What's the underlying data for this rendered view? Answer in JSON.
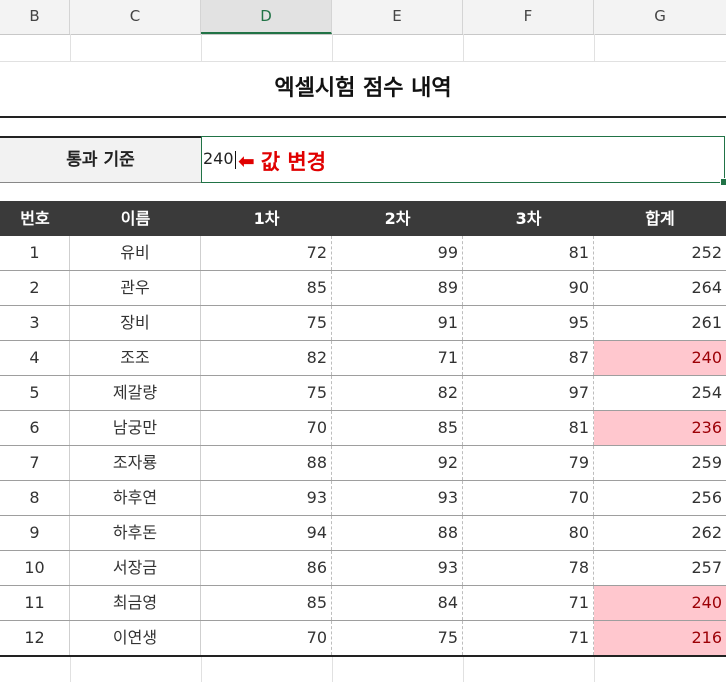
{
  "sheet": {
    "columns": [
      "B",
      "C",
      "D",
      "E",
      "F",
      "G"
    ],
    "selected_column": "D"
  },
  "title": "엑셀시험 점수 내역",
  "criteria": {
    "label": "통과 기준",
    "value": "240",
    "annotation": "값 변경"
  },
  "table": {
    "headers": [
      "번호",
      "이름",
      "1차",
      "2차",
      "3차",
      "합계"
    ],
    "rows": [
      {
        "no": "1",
        "name": "유비",
        "s1": "72",
        "s2": "99",
        "s3": "81",
        "total": "252",
        "highlight": false
      },
      {
        "no": "2",
        "name": "관우",
        "s1": "85",
        "s2": "89",
        "s3": "90",
        "total": "264",
        "highlight": false
      },
      {
        "no": "3",
        "name": "장비",
        "s1": "75",
        "s2": "91",
        "s3": "95",
        "total": "261",
        "highlight": false
      },
      {
        "no": "4",
        "name": "조조",
        "s1": "82",
        "s2": "71",
        "s3": "87",
        "total": "240",
        "highlight": true
      },
      {
        "no": "5",
        "name": "제갈량",
        "s1": "75",
        "s2": "82",
        "s3": "97",
        "total": "254",
        "highlight": false
      },
      {
        "no": "6",
        "name": "남궁만",
        "s1": "70",
        "s2": "85",
        "s3": "81",
        "total": "236",
        "highlight": true
      },
      {
        "no": "7",
        "name": "조자룡",
        "s1": "88",
        "s2": "92",
        "s3": "79",
        "total": "259",
        "highlight": false
      },
      {
        "no": "8",
        "name": "하후연",
        "s1": "93",
        "s2": "93",
        "s3": "70",
        "total": "256",
        "highlight": false
      },
      {
        "no": "9",
        "name": "하후돈",
        "s1": "94",
        "s2": "88",
        "s3": "80",
        "total": "262",
        "highlight": false
      },
      {
        "no": "10",
        "name": "서장금",
        "s1": "86",
        "s2": "93",
        "s3": "78",
        "total": "257",
        "highlight": false
      },
      {
        "no": "11",
        "name": "최금영",
        "s1": "85",
        "s2": "84",
        "s3": "71",
        "total": "240",
        "highlight": true
      },
      {
        "no": "12",
        "name": "이연생",
        "s1": "70",
        "s2": "75",
        "s3": "71",
        "total": "216",
        "highlight": true
      }
    ]
  },
  "colors": {
    "highlight_fill": "#ffc7ce",
    "highlight_text": "#9c0006",
    "selection": "#217346",
    "annotation": "#e00000",
    "header_bg": "#3a3a3a"
  }
}
